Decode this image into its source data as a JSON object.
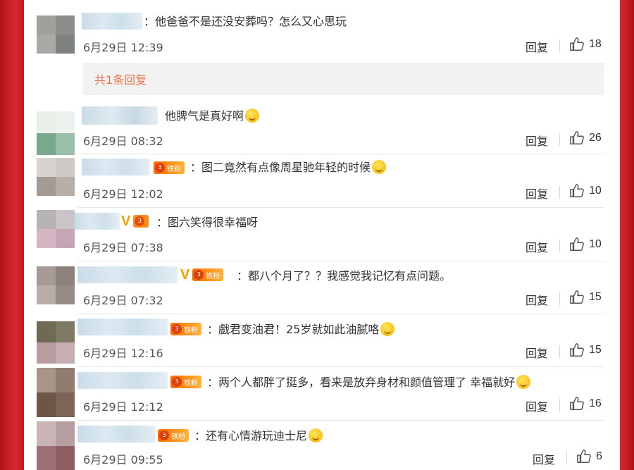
{
  "comments": [
    {
      "text": "他爸爸不是还没安葬吗？怎么又心思玩",
      "date": "6月29日 12:39",
      "reply": "回复",
      "likes": "18",
      "emoji": false
    },
    {
      "text": "他脾气是真好啊",
      "date": "6月29日 08:32",
      "reply": "回复",
      "likes": "26",
      "emoji": true
    },
    {
      "text": "图二竟然有点像周星驰年轻的时候",
      "date": "6月29日 12:02",
      "reply": "回复",
      "likes": "10",
      "emoji": true
    },
    {
      "text": "图六笑得很幸福呀",
      "date": "6月29日 07:38",
      "reply": "回复",
      "likes": "10",
      "emoji": false
    },
    {
      "text": "都八个月了？？我感觉我记忆有点问题。",
      "date": "6月29日 07:32",
      "reply": "回复",
      "likes": "15",
      "emoji": false
    },
    {
      "text": "戲君变油君！25岁就如此油腻咯",
      "date": "6月29日 12:16",
      "reply": "回复",
      "likes": "15",
      "emoji": true
    },
    {
      "text": "两个人都胖了挺多，看来是放弃身材和颜值管理了 幸福就好",
      "date": "6月29日 12:12",
      "reply": "回复",
      "likes": "16",
      "emoji": true
    },
    {
      "text": "还有心情游玩迪士尼",
      "date": "6月29日 09:55",
      "reply": "回复",
      "likes": "6",
      "emoji": true
    }
  ],
  "sub_reply": {
    "label": "共1条回复"
  },
  "badges": {
    "fan": "铁粉",
    "level": "3"
  },
  "colors": {
    "frame": "#c8161d",
    "link": "#eb7350",
    "vip": "#f2a000"
  }
}
